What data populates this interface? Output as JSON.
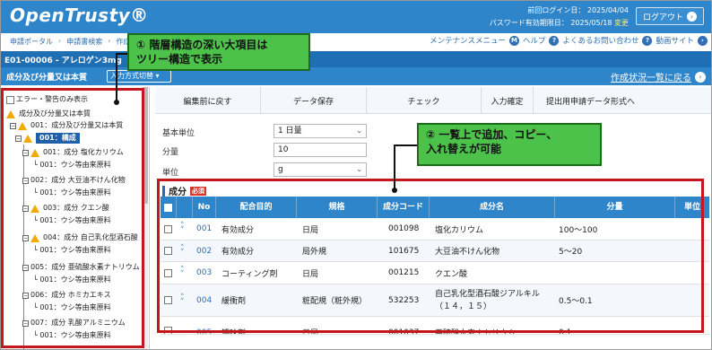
{
  "header": {
    "logo": "OpenTrusty®",
    "last_login_label": "前回ログイン日：",
    "last_login_value": "2025/04/04",
    "pw_expiry_label": "パスワード有効期限日：",
    "pw_expiry_value": "2025/05/18",
    "pw_renew": "変更",
    "logout": "ログアウト"
  },
  "breadcrumb": [
    "申請ポータル",
    "申請書検索",
    "作成"
  ],
  "toplinks": {
    "maintenance": "メンテナンスメニュー",
    "help": "ヘルプ",
    "faq": "よくあるお問い合わせ",
    "video": "動画サイト"
  },
  "title": {
    "code": "E01-00006 - アレロゲン3mg"
  },
  "subbar": {
    "label": "成分及び分量又は本質",
    "select": "入力方式切替",
    "right_link": "作成状況一覧に戻る"
  },
  "tree": {
    "filter_label": "エラー・警告のみ表示",
    "items": [
      "成分及び分量又は本質",
      "001：成分及び分量又は本質",
      "001：構成",
      "001：成分 塩化カリウム",
      "└ 001：ウシ等由来原料",
      "002：成分 大豆油不けん化物",
      "└ 001：ウシ等由来原料",
      "003：成分 クエン酸",
      "└ 001：ウシ等由来原料",
      "004：成分 自己乳化型酒石酸",
      "└ 001：ウシ等由来原料",
      "005：成分 亜硫酸水素ナトリウム",
      "└ 001：ウシ等由来原料",
      "006：成分 ホミカエキス",
      "└ 001：ウシ等由来原料",
      "007：成分 乳酸アルミニウム",
      "└ 001：ウシ等由来原料"
    ]
  },
  "toolbar": [
    "編集前に戻す",
    "データ保存",
    "チェック",
    "入力確定",
    "提出用申請データ形式へ"
  ],
  "form": {
    "base_unit_label": "基本単位",
    "base_unit_value": "1 日量",
    "amount_label": "分量",
    "amount_value": "10",
    "unit_label": "単位",
    "unit_value": "g"
  },
  "section": {
    "title": "成分",
    "required": "必須"
  },
  "table": {
    "headers": [
      "No",
      "配合目的",
      "規格",
      "成分コード",
      "成分名",
      "分量",
      "単位"
    ],
    "rows": [
      {
        "no": "001",
        "purpose": "有効成分",
        "spec": "日局",
        "code": "001098",
        "name": "塩化カリウム",
        "amount": "100～100"
      },
      {
        "no": "002",
        "purpose": "有効成分",
        "spec": "局外規",
        "code": "101675",
        "name": "大豆油不けん化物",
        "amount": "5～20"
      },
      {
        "no": "003",
        "purpose": "コーティング剤",
        "spec": "日局",
        "code": "001215",
        "name": "クエン酸",
        "amount": ""
      },
      {
        "no": "004",
        "purpose": "緩衝剤",
        "spec": "粧配規（粧外規）",
        "code": "532253",
        "name": "自己乳化型酒石酸ジアルキル（１４，１５）",
        "amount": "0.5～0.1"
      },
      {
        "no": "005",
        "purpose": "矯味剤",
        "spec": "日局",
        "code": "001037",
        "name": "亜硫酸水素ナトリウム",
        "amount": "0.1"
      }
    ]
  },
  "callouts": {
    "c1": "① 階層構造の深い大項目は\nツリー構造で表示",
    "c2": "② 一覧上で追加、コピー、\n入れ替えが可能"
  }
}
